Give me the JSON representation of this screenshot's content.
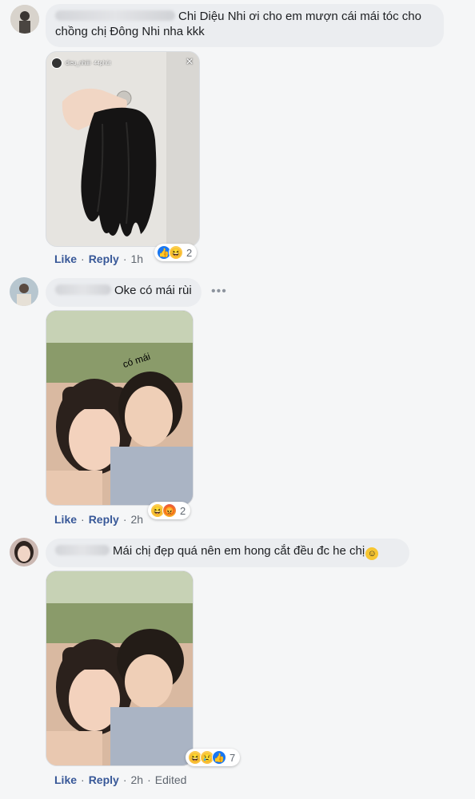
{
  "comments": [
    {
      "text": "Chi Diệu Nhi ơi cho em mượn cái mái tóc cho chồng chị Đông Nhi nha kkk",
      "story_username": "dieu_nhiiii",
      "story_time": "44phút",
      "actions": {
        "like": "Like",
        "reply": "Reply",
        "time": "1h"
      },
      "reaction_count": "2"
    },
    {
      "text": "Oke có mái rùi",
      "photo_caption": "có mái",
      "actions": {
        "like": "Like",
        "reply": "Reply",
        "time": "2h"
      },
      "reaction_count": "2"
    },
    {
      "text": "Mái chị đẹp quá nên em hong cắt đều đc he chị",
      "actions": {
        "like": "Like",
        "reply": "Reply",
        "time": "2h",
        "edited": "Edited"
      },
      "reaction_count": "7"
    }
  ],
  "separator": "·",
  "icons": {
    "like": "like-reaction-icon",
    "haha": "haha-reaction-icon",
    "angry": "angry-reaction-icon",
    "sad": "sad-reaction-icon",
    "smile": "smile-emoji-icon",
    "close": "close-icon",
    "more": "more-options-icon"
  },
  "colors": {
    "link": "#385898",
    "bubble": "#ebedf0",
    "like": "#1877f2"
  }
}
